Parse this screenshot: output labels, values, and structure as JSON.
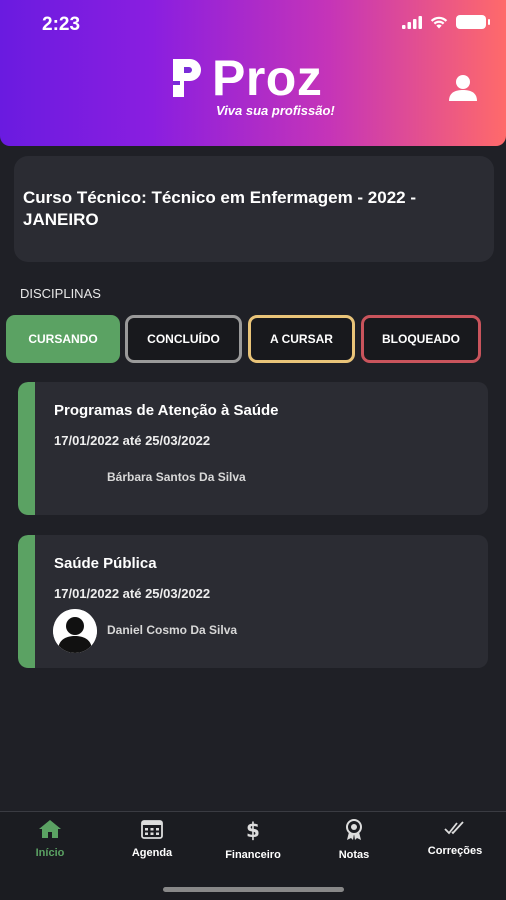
{
  "status": {
    "time": "2:23"
  },
  "brand": {
    "name": "Proz",
    "tagline": "Viva sua profissão!"
  },
  "course": {
    "title": "Curso Técnico: Técnico em Enfermagem - 2022 - JANEIRO"
  },
  "disciplines_label": "DISCIPLINAS",
  "filters": [
    {
      "label": "CURSANDO",
      "active": true,
      "color": "#5ba263"
    },
    {
      "label": "CONCLUÍDO",
      "active": false,
      "color": "#9a9a9a"
    },
    {
      "label": "A CURSAR",
      "active": false,
      "color": "#e9c479"
    },
    {
      "label": "BLOQUEADO",
      "active": false,
      "color": "#c9545c"
    }
  ],
  "disciplines": [
    {
      "title": "Programas de Atenção à Saúde",
      "dates": "17/01/2022 até 25/03/2022",
      "teacher": "Bárbara Santos Da Silva",
      "avatar": "none"
    },
    {
      "title": "Saúde Pública",
      "dates": "17/01/2022 até 25/03/2022",
      "teacher": "Daniel Cosmo Da Silva",
      "avatar": "person-avatar"
    }
  ],
  "tabs": [
    {
      "label": "Início",
      "icon": "home-icon",
      "active": true
    },
    {
      "label": "Agenda",
      "icon": "calendar-icon",
      "active": false
    },
    {
      "label": "Financeiro",
      "icon": "dollar-icon",
      "active": false
    },
    {
      "label": "Notas",
      "icon": "award-icon",
      "active": false
    },
    {
      "label": "Correções",
      "icon": "double-check-icon",
      "active": false
    }
  ],
  "colors": {
    "accent_green": "#5ba263",
    "background": "#1f2026",
    "card": "#2b2c33"
  }
}
